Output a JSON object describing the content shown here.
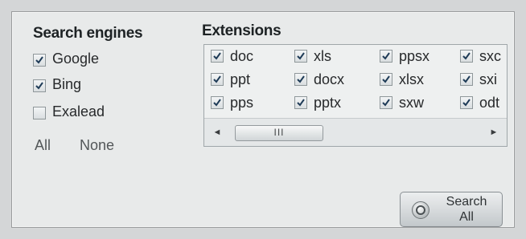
{
  "search_engines": {
    "heading": "Search engines",
    "items": [
      {
        "label": "Google",
        "checked": true
      },
      {
        "label": "Bing",
        "checked": true
      },
      {
        "label": "Exalead",
        "checked": false
      }
    ],
    "select_all": "All",
    "select_none": "None"
  },
  "extensions": {
    "heading": "Extensions",
    "items": [
      {
        "label": "doc",
        "checked": true
      },
      {
        "label": "xls",
        "checked": true
      },
      {
        "label": "ppsx",
        "checked": true
      },
      {
        "label": "sxc",
        "checked": true
      },
      {
        "label": "ppt",
        "checked": true
      },
      {
        "label": "docx",
        "checked": true
      },
      {
        "label": "xlsx",
        "checked": true
      },
      {
        "label": "sxi",
        "checked": true
      },
      {
        "label": "pps",
        "checked": true
      },
      {
        "label": "pptx",
        "checked": true
      },
      {
        "label": "sxw",
        "checked": true
      },
      {
        "label": "odt",
        "checked": true
      }
    ],
    "scroll_left": "◄",
    "scroll_right": "►",
    "scroll_thumb": "III"
  },
  "search_button": {
    "line1": "Search",
    "line2": "All",
    "icon": "search-globe-icon"
  }
}
